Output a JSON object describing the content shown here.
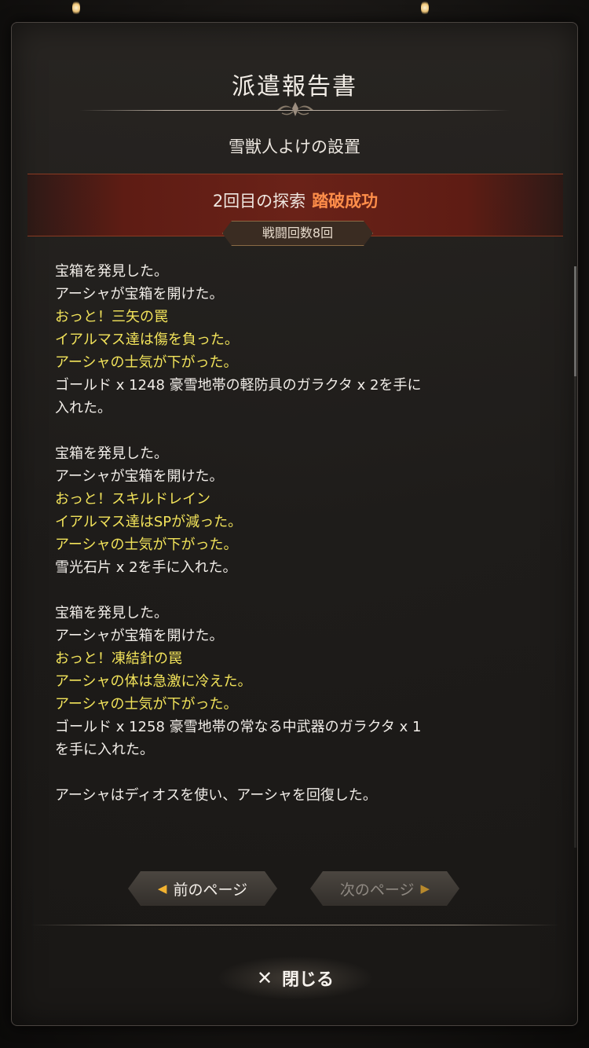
{
  "panel": {
    "title": "派遣報告書",
    "subtitle": "雪獣人よけの設置"
  },
  "result": {
    "prefix": "2回目の探索",
    "status": "踏破成功",
    "battle_count": "戦闘回数8回"
  },
  "log": [
    {
      "text": "宝箱を発見した。",
      "style": "white"
    },
    {
      "text": "アーシャが宝箱を開けた。",
      "style": "white"
    },
    {
      "text": "おっと！三矢の罠",
      "style": "yellow"
    },
    {
      "text": "イアルマス達は傷を負った。",
      "style": "yellow"
    },
    {
      "text": "アーシャの士気が下がった。",
      "style": "yellow"
    },
    {
      "text": "ゴールド x 1248 豪雪地帯の軽防具のガラクタ x 2を手に",
      "style": "white"
    },
    {
      "text": "入れた。",
      "style": "white"
    },
    {
      "text": "",
      "style": "white"
    },
    {
      "text": "宝箱を発見した。",
      "style": "white"
    },
    {
      "text": "アーシャが宝箱を開けた。",
      "style": "white"
    },
    {
      "text": "おっと！スキルドレイン",
      "style": "yellow"
    },
    {
      "text": "イアルマス達はSPが減った。",
      "style": "yellow"
    },
    {
      "text": "アーシャの士気が下がった。",
      "style": "yellow"
    },
    {
      "text": "雪光石片 x 2を手に入れた。",
      "style": "white"
    },
    {
      "text": "",
      "style": "white"
    },
    {
      "text": "宝箱を発見した。",
      "style": "white"
    },
    {
      "text": "アーシャが宝箱を開けた。",
      "style": "white"
    },
    {
      "text": "おっと！凍結針の罠",
      "style": "yellow"
    },
    {
      "text": "アーシャの体は急激に冷えた。",
      "style": "yellow"
    },
    {
      "text": "アーシャの士気が下がった。",
      "style": "yellow"
    },
    {
      "text": "ゴールド x 1258 豪雪地帯の常なる中武器のガラクタ x 1",
      "style": "white"
    },
    {
      "text": "を手に入れた。",
      "style": "white"
    },
    {
      "text": "",
      "style": "white"
    },
    {
      "text": "アーシャはディオスを使い、アーシャを回復した。",
      "style": "white"
    },
    {
      "text": "",
      "style": "white"
    }
  ],
  "nav": {
    "prev_label": "前のページ",
    "next_label": "次のページ",
    "prev_icon": "arrow-left-icon",
    "next_icon": "arrow-right-icon"
  },
  "close": {
    "label": "閉じる",
    "icon": "close-icon"
  },
  "colors": {
    "success": "#ff8e4a",
    "event_text": "#f2e35a",
    "accent_arrow": "#f2b230"
  }
}
